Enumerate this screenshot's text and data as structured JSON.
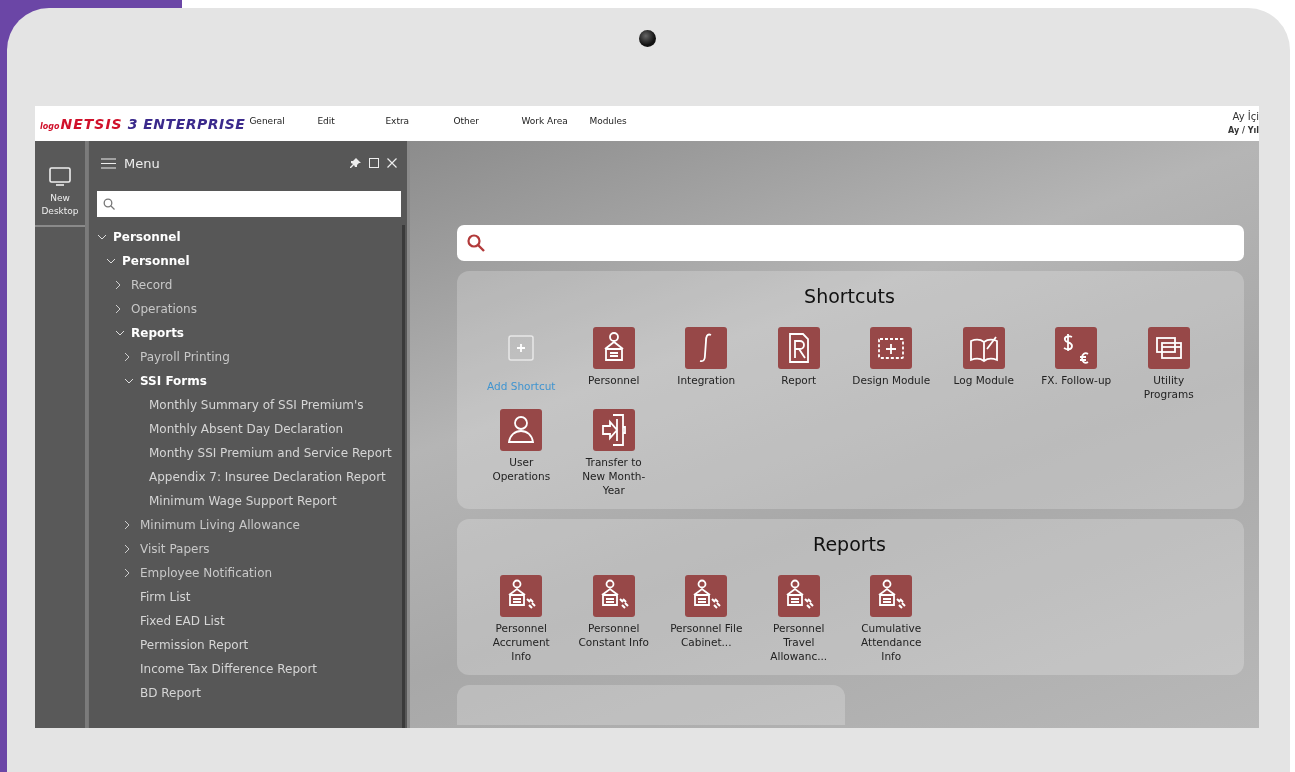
{
  "app": {
    "logo": {
      "prefix": "logo",
      "name": "NETSIS",
      "suffix": "3 ENTERPRISE"
    },
    "menu_bar": [
      "General",
      "Edit",
      "Extra",
      "Other",
      "Work Area",
      "Modules"
    ],
    "period": {
      "line_1": "Ay İçi",
      "line_2": "Ay / Yıl"
    }
  },
  "rail": {
    "label": "New Desktop"
  },
  "menu_panel": {
    "title": "Menu",
    "tree": [
      {
        "label": "Personnel",
        "expanded": true,
        "children": [
          {
            "label": "Personnel",
            "expanded": true,
            "children": [
              {
                "label": "Record",
                "expanded": false
              },
              {
                "label": "Operations",
                "expanded": false
              },
              {
                "label": "Reports",
                "expanded": true,
                "children": [
                  {
                    "label": "Payroll Printing",
                    "expanded": false
                  },
                  {
                    "label": "SSI Forms",
                    "expanded": true,
                    "children": [
                      {
                        "label": "Monthly Summary of SSI Premium's"
                      },
                      {
                        "label": "Monthly Absent Day Declaration"
                      },
                      {
                        "label": "Monthy SSI Premium and Service Report"
                      },
                      {
                        "label": "Appendix 7: Insuree Declaration Report"
                      },
                      {
                        "label": "Minimum Wage Support Report"
                      }
                    ]
                  },
                  {
                    "label": "Minimum Living Allowance",
                    "expanded": false
                  },
                  {
                    "label": "Visit Papers",
                    "expanded": false
                  },
                  {
                    "label": "Employee Notification",
                    "expanded": false
                  },
                  {
                    "label": "Firm List"
                  },
                  {
                    "label": "Fixed EAD List"
                  },
                  {
                    "label": "Permission Report"
                  },
                  {
                    "label": "Income Tax Difference Report"
                  },
                  {
                    "label": "BD Report"
                  }
                ]
              }
            ]
          }
        ]
      }
    ]
  },
  "main": {
    "sections": [
      {
        "title": "Shortcuts",
        "tiles": [
          {
            "kind": "add",
            "label": "Add Shortcut"
          },
          {
            "kind": "module",
            "label": "Personnel"
          },
          {
            "kind": "module",
            "label": "Integration"
          },
          {
            "kind": "module",
            "label": "Report"
          },
          {
            "kind": "module",
            "label": "Design Module"
          },
          {
            "kind": "module",
            "label": "Log Module"
          },
          {
            "kind": "module",
            "label": "FX. Follow-up"
          },
          {
            "kind": "module",
            "label": "Utility Programs"
          },
          {
            "kind": "module",
            "label": "User Operations"
          },
          {
            "kind": "module",
            "label": "Transfer to New Month-Year"
          }
        ]
      },
      {
        "title": "Reports",
        "tiles": [
          {
            "kind": "report",
            "label": "Personnel Accrument Info"
          },
          {
            "kind": "report",
            "label": "Personnel Constant Info"
          },
          {
            "kind": "report",
            "label": "Personnel File Cabinet..."
          },
          {
            "kind": "report",
            "label": "Personnel Travel Allowanc..."
          },
          {
            "kind": "report",
            "label": "Cumulative Attendance Info"
          }
        ]
      }
    ]
  }
}
